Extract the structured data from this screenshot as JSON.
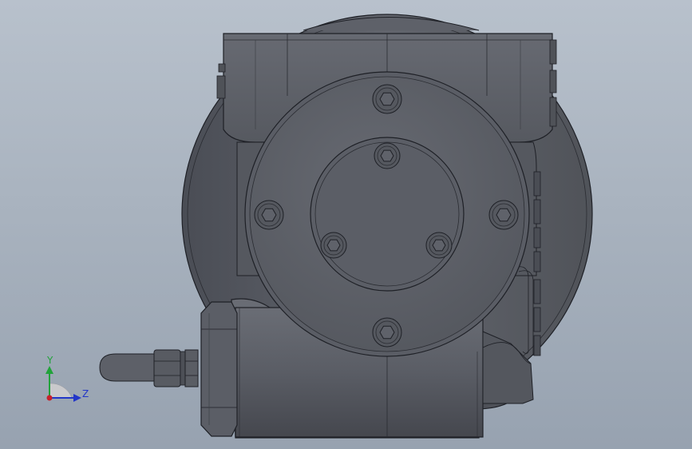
{
  "viewport": {
    "background_top": "#b8c1cc",
    "background_bottom": "#97a2b0",
    "model_color": "#5b5e66",
    "edge_color": "#1e2026"
  },
  "model": {
    "name": "worm gearbox",
    "view": "front",
    "visible_bolts": 7
  },
  "triad": {
    "y_label": "Y",
    "z_label": "Z",
    "y_color": "#21a33a",
    "z_color": "#2236c8",
    "x_color": "#c8202a"
  }
}
